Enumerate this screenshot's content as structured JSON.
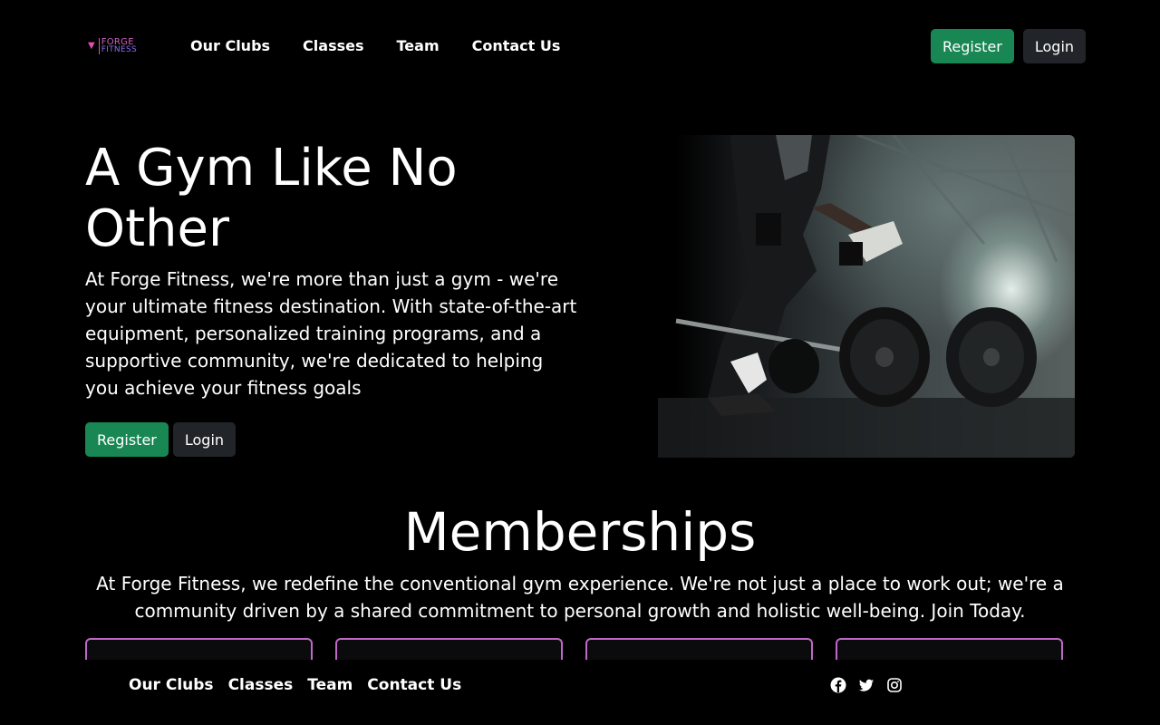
{
  "brand": {
    "logo_line1": "FORGE",
    "logo_line2": "FITNESS",
    "colors": {
      "accent_pink": "#c068c8",
      "logo_purple": "#8e6cf2",
      "button_green": "#198754",
      "button_dark": "#212529",
      "background": "#000000"
    }
  },
  "nav": {
    "links": [
      "Our Clubs",
      "Classes",
      "Team",
      "Contact Us"
    ],
    "register_label": "Register",
    "login_label": "Login"
  },
  "hero": {
    "title": "A Gym Like No Other",
    "description": "At Forge Fitness, we're more than just a gym - we're your ultimate fitness destination. With state-of-the-art equipment, personalized training programs, and a supportive community, we're dedicated to helping you achieve your fitness goals",
    "register_label": "Register",
    "login_label": "Login"
  },
  "memberships": {
    "title": "Memberships",
    "description": "At Forge Fitness, we redefine the conventional gym experience. We're not just a place to work out; we're a community driven by a shared commitment to personal growth and holistic well-being. Join Today."
  },
  "footer": {
    "links": [
      "Our Clubs",
      "Classes",
      "Team",
      "Contact Us"
    ],
    "social_icons": [
      "facebook-icon",
      "twitter-icon",
      "instagram-icon"
    ]
  }
}
